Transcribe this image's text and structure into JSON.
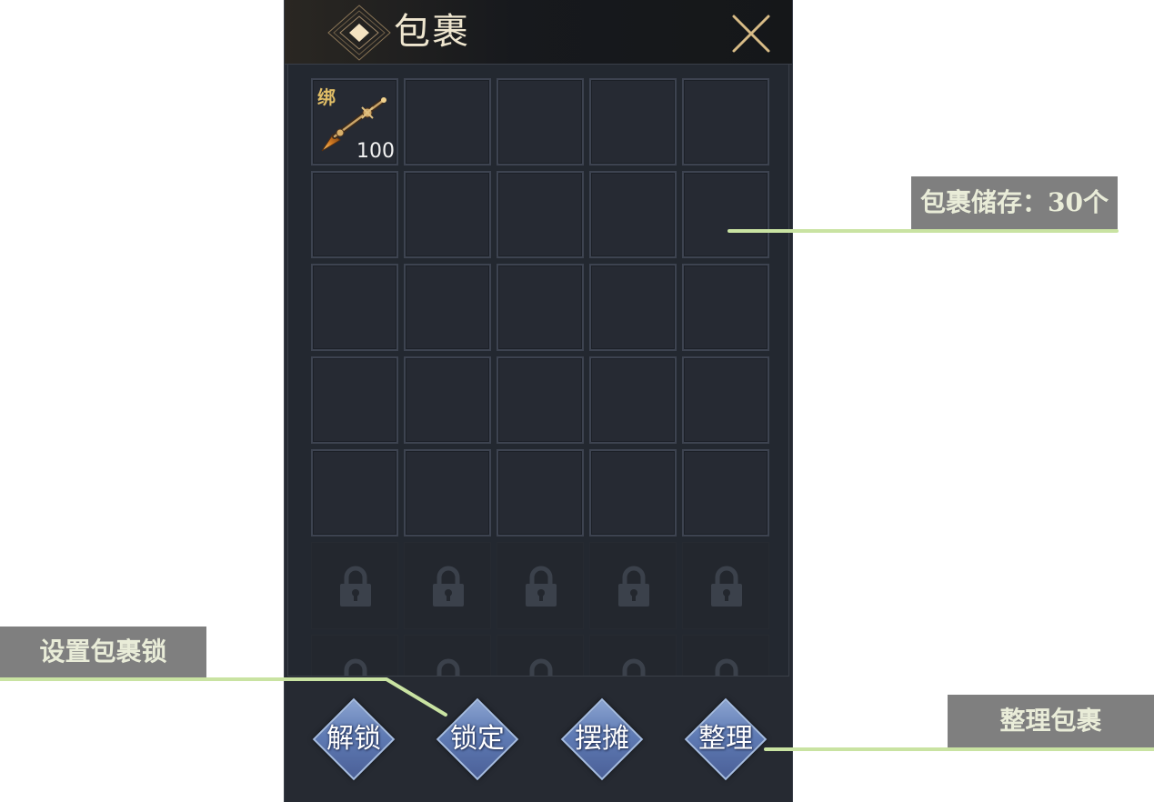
{
  "window": {
    "title": "包裹",
    "close_icon": "close-icon"
  },
  "inventory": {
    "columns": 5,
    "unlocked_slots": 25,
    "locked_slots_visible": 10,
    "items": [
      {
        "slot": 0,
        "icon": "spear-icon",
        "bound_label": "绑",
        "quantity": "100"
      }
    ]
  },
  "buttons": [
    {
      "id": "unlock",
      "label": "解锁"
    },
    {
      "id": "lock",
      "label": "锁定"
    },
    {
      "id": "stall",
      "label": "摆摊"
    },
    {
      "id": "sort",
      "label": "整理"
    }
  ],
  "annotations": {
    "storage": "包裹储存：30个",
    "set_lock": "设置包裹锁",
    "sort": "整理包裹"
  },
  "colors": {
    "panel_bg": "#262a32",
    "slot_border": "#3d4350",
    "button_blue": "#5f7bb4",
    "annotation_bg": "#7f7f7f",
    "annotation_line": "#c9e3a2",
    "title_text": "#efe6cf",
    "close_gold": "#d7bb86",
    "bound_gold": "#e0bd66"
  }
}
